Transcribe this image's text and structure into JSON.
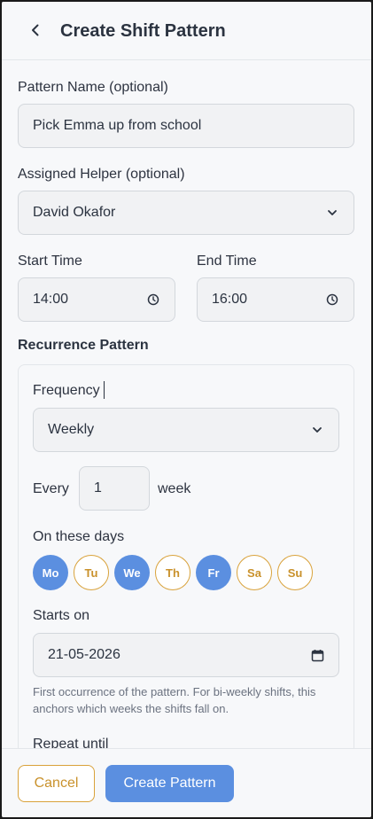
{
  "header": {
    "title": "Create Shift Pattern"
  },
  "form": {
    "pattern_name": {
      "label": "Pattern Name (optional)",
      "value": "Pick Emma up from school"
    },
    "helper": {
      "label": "Assigned Helper (optional)",
      "value": "David Okafor"
    },
    "start_time": {
      "label": "Start Time",
      "value": "14:00"
    },
    "end_time": {
      "label": "End Time",
      "value": "16:00"
    }
  },
  "recurrence": {
    "title": "Recurrence Pattern",
    "frequency_label": "Frequency",
    "frequency_value": "Weekly",
    "every_label": "Every",
    "every_value": "1",
    "unit_label": "week",
    "days_label": "On these days",
    "days": [
      {
        "label": "Mo",
        "selected": true
      },
      {
        "label": "Tu",
        "selected": false
      },
      {
        "label": "We",
        "selected": true
      },
      {
        "label": "Th",
        "selected": false
      },
      {
        "label": "Fr",
        "selected": true
      },
      {
        "label": "Sa",
        "selected": false
      },
      {
        "label": "Su",
        "selected": false
      }
    ],
    "starts_on_label": "Starts on",
    "starts_on_value": "21-05-2026",
    "starts_on_hint": "First occurrence of the pattern. For bi-weekly shifts, this anchors which weeks the shifts fall on.",
    "repeat_until_label": "Repeat until"
  },
  "footer": {
    "cancel_label": "Cancel",
    "create_label": "Create Pattern"
  },
  "colors": {
    "accent": "#5b8fe0",
    "secondary": "#d9a23a"
  }
}
